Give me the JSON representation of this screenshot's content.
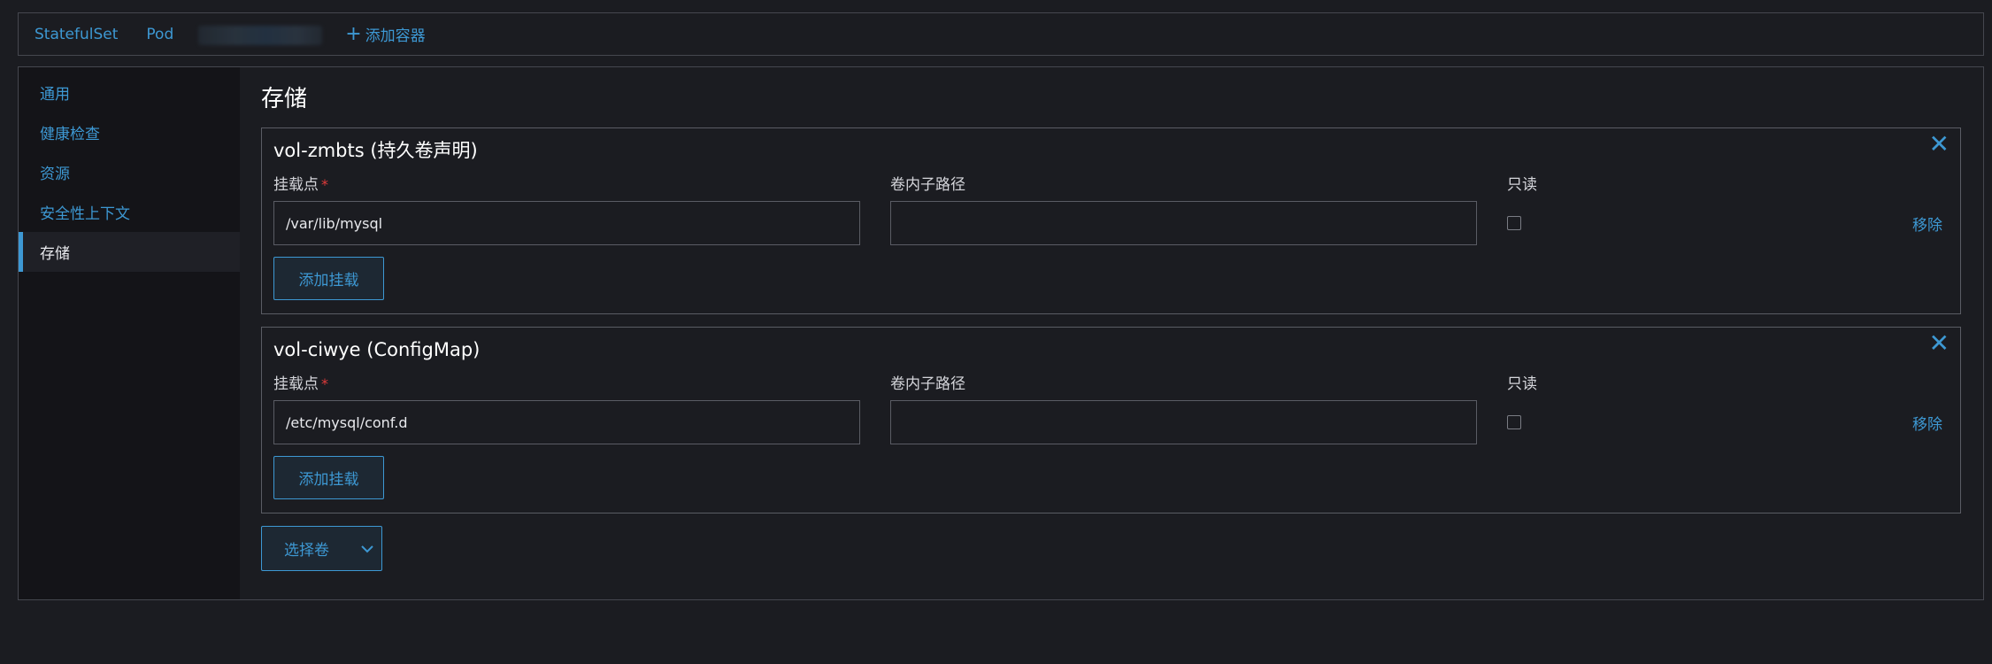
{
  "tabs": {
    "items": [
      {
        "label": "StatefulSet"
      },
      {
        "label": "Pod"
      }
    ],
    "add_container_label": "添加容器"
  },
  "sidebar": {
    "items": [
      {
        "label": "通用"
      },
      {
        "label": "健康检查"
      },
      {
        "label": "资源"
      },
      {
        "label": "安全性上下文"
      },
      {
        "label": "存储",
        "active": true
      }
    ]
  },
  "storage": {
    "title": "存储",
    "mount_point_label": "挂载点",
    "sub_path_label": "卷内子路径",
    "read_only_label": "只读",
    "remove_label": "移除",
    "add_mount_label": "添加挂载",
    "volumes": [
      {
        "title": "vol-zmbts (持久卷声明)",
        "mount_point": "/var/lib/mysql",
        "sub_path": "",
        "read_only": false
      },
      {
        "title": "vol-ciwye (ConfigMap)",
        "mount_point": "/etc/mysql/conf.d",
        "sub_path": "",
        "read_only": false
      }
    ],
    "select_volume_label": "选择卷"
  },
  "colors": {
    "accent": "#3d98d3",
    "background": "#1b1c21",
    "required": "#e03b3b"
  },
  "icons": {
    "close": "close-icon",
    "dropdown": "chevron-down-icon",
    "add": "plus-icon"
  }
}
